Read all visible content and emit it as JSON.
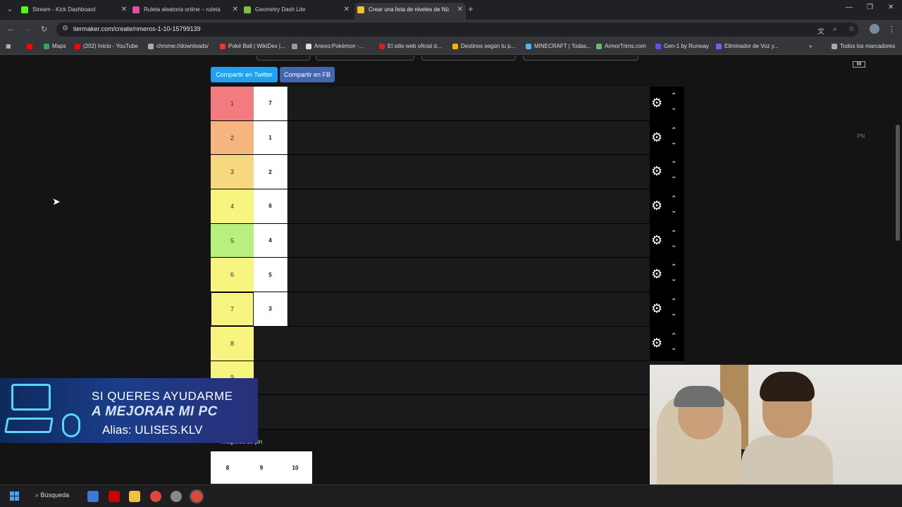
{
  "tabs": [
    {
      "title": "Stream - Kick Dashboard",
      "favicon_color": "#53fc18",
      "active": false
    },
    {
      "title": "Ruleta aleatoria online – ruleta",
      "favicon_color": "#e44d9c",
      "active": false
    },
    {
      "title": "Geometry Dash Lite",
      "favicon_color": "#7ec23a",
      "active": false
    },
    {
      "title": "Crear una lista de niveles de Nú",
      "favicon_color": "#f0c030",
      "active": true
    }
  ],
  "address": {
    "url": "tiermaker.com/create/nmeros-1-10-15799139"
  },
  "bookmarks": [
    {
      "label": "",
      "color": "#ff0000"
    },
    {
      "label": "Maps",
      "color": "#34a853"
    },
    {
      "label": "(202) Inicio - YouTube",
      "color": "#ff0000"
    },
    {
      "label": "chrome://downloads/",
      "color": "#aaaaaa"
    },
    {
      "label": "Poké Ball | WikiDex |...",
      "color": "#e33"
    },
    {
      "label": "",
      "color": "#999999"
    },
    {
      "label": "Anexo:Pokémon -...",
      "color": "#dddddd"
    },
    {
      "label": "El sitio web oficial d...",
      "color": "#cc2222"
    },
    {
      "label": "Destinos según tu p...",
      "color": "#f4b400"
    },
    {
      "label": "MINECRAFT | Todas...",
      "color": "#5ab0f0"
    },
    {
      "label": "ArmorTrims.com",
      "color": "#66bb66"
    },
    {
      "label": "Gen-1 by Runway",
      "color": "#5555ee"
    },
    {
      "label": "Eliminador de Voz y...",
      "color": "#7b5cff"
    }
  ],
  "bookmarks_all": "Todos los marcadores",
  "share": {
    "twitter": "Compartir en Twitter",
    "facebook": "Compartir en FB"
  },
  "tiers": [
    {
      "label": "1",
      "color": "#f27b7f",
      "item": "7"
    },
    {
      "label": "2",
      "color": "#f6b47f",
      "item": "1"
    },
    {
      "label": "3",
      "color": "#f6d87f",
      "item": "2"
    },
    {
      "label": "4",
      "color": "#f7f47f",
      "item": "6"
    },
    {
      "label": "5",
      "color": "#b8f07f",
      "item": "4"
    },
    {
      "label": "6",
      "color": "#f7f47f",
      "item": "5"
    },
    {
      "label": "7",
      "color": "#f7f47f",
      "item": "3"
    },
    {
      "label": "8",
      "color": "#f7f47f",
      "item": ""
    },
    {
      "label": "9",
      "color": "#f7f47f",
      "item": ""
    },
    {
      "label": "",
      "color": "#f7f47f",
      "item": ""
    }
  ],
  "pool": {
    "label": "Imágenes de pin",
    "items": [
      "8",
      "9",
      "10"
    ]
  },
  "side_text": "PN",
  "banner": {
    "line1": "SI QUERES AYUDARME",
    "line2": "A MEJORAR MI PC",
    "line3": "Alias: ULISES.KLV"
  },
  "taskbar": {
    "search": "Búsqueda"
  }
}
